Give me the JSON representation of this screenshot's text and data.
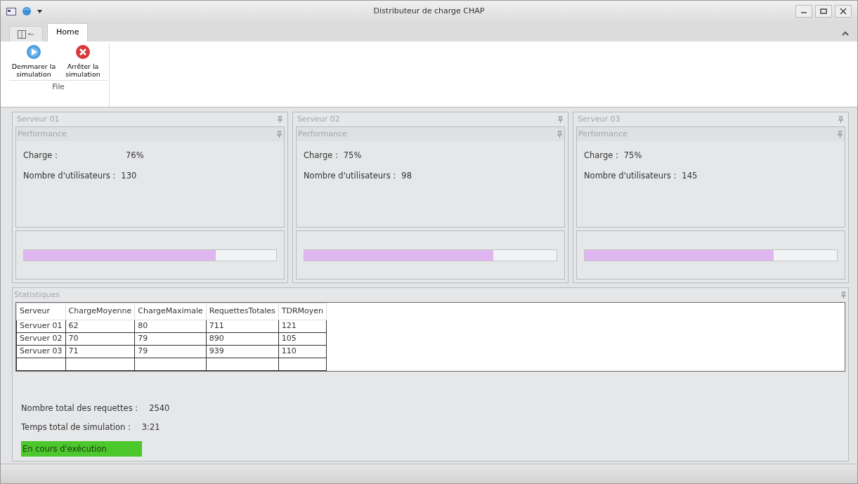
{
  "window": {
    "title": "Distributeur de charge CHAP"
  },
  "ribbon": {
    "tabs": [
      {
        "label": "Home",
        "selected": true
      }
    ],
    "buttons": [
      {
        "label": "Demmarer la simulation",
        "kind": "start"
      },
      {
        "label": "Arrêter la simulation",
        "kind": "stop"
      }
    ],
    "group": "File"
  },
  "servers": [
    {
      "title": "Serveur 01",
      "panel": "Performance",
      "charge_label": "Charge :",
      "charge": "76%",
      "users_label": "Nombre d'utilisateurs :",
      "users": "130",
      "level": 0.76
    },
    {
      "title": "Serveur 02",
      "panel": "Performance",
      "charge_label": "Charge :",
      "charge": "75%",
      "users_label": "Nombre d'utilisateurs :",
      "users": "98",
      "level": 0.75
    },
    {
      "title": "Serveur 03",
      "panel": "Performance",
      "charge_label": "Charge :",
      "charge": "75%",
      "users_label": "Nombre d'utilisateurs :",
      "users": "145",
      "level": 0.75
    }
  ],
  "statistics": {
    "title": "Statistiques",
    "table": {
      "columns": [
        "Serveur",
        "ChargeMoyenne",
        "ChargeMaximale",
        "RequettesTotales",
        "TDRMoyen"
      ],
      "rows": [
        [
          "Servuer 01",
          "62",
          "80",
          "711",
          "121"
        ],
        [
          "Servuer 02",
          "70",
          "79",
          "890",
          "105"
        ],
        [
          "Servuer 03",
          "71",
          "79",
          "939",
          "110"
        ]
      ]
    },
    "total_label": "Nombre total des requettes :",
    "total": "2540",
    "time_label": "Temps total de simulation :",
    "time": "3:21",
    "status": {
      "text": "En cours d'exécution",
      "color": "#4cc72c"
    }
  }
}
